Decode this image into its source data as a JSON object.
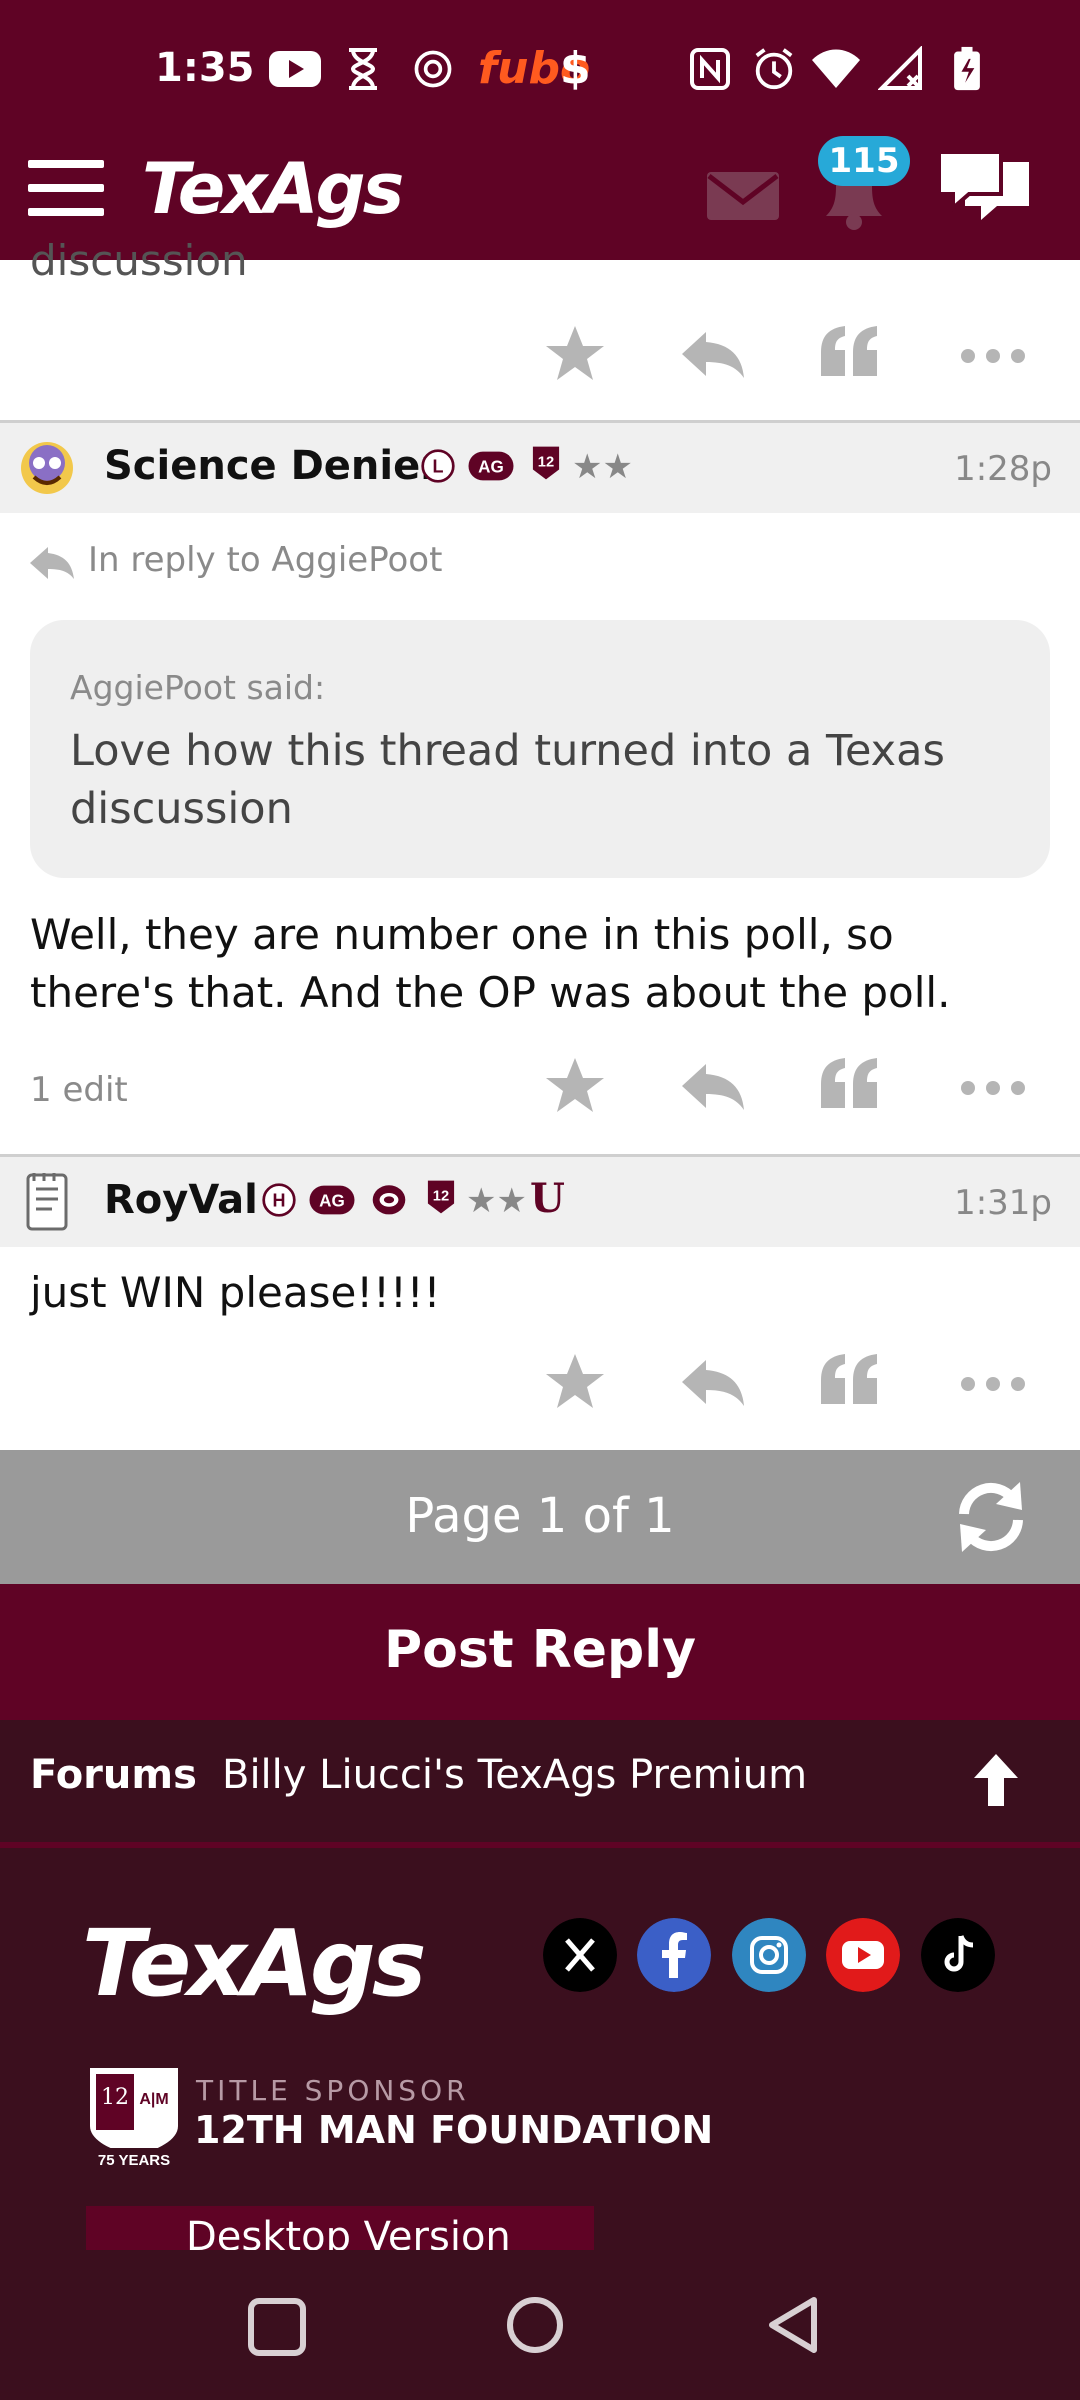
{
  "status_bar": {
    "time": "1:35",
    "icons": [
      "youtube-icon",
      "hourglass-icon",
      "openai-icon",
      "fubo-icon",
      "dollar-icon",
      "nfc-icon",
      "alarm-icon",
      "wifi-icon",
      "signal-icon",
      "battery-icon"
    ],
    "fubo_text": "fubo",
    "dollar_text": "$"
  },
  "header": {
    "logo": "TexAgs",
    "notification_count": "115"
  },
  "posts": [
    {
      "partial_text": "discussion"
    },
    {
      "username": "Science Denier",
      "time": "1:28p",
      "badges": [
        "L",
        "AG",
        "12",
        "★★"
      ],
      "reply_to": "In reply to AggiePoot",
      "quote_author": "AggiePoot said:",
      "quote_text": "Love how this thread turned into a Texas discussion",
      "body": "Well, they are number one in this poll, so there's that. And the OP was about the poll.",
      "edits": "1 edit"
    },
    {
      "username": "RoyVal",
      "time": "1:31p",
      "badges": [
        "H",
        "AG",
        "12",
        "★★",
        "U"
      ],
      "body": "just WIN please!!!!!"
    }
  ],
  "pagination": {
    "label": "Page 1 of 1"
  },
  "post_reply": {
    "label": "Post Reply"
  },
  "breadcrumb": {
    "forums": "Forums",
    "board": "Billy Liucci's TexAgs Premium"
  },
  "footer": {
    "logo": "TexAgs",
    "social": [
      "x-icon",
      "facebook-icon",
      "instagram-icon",
      "youtube-icon",
      "tiktok-icon"
    ],
    "sponsor_label": "TITLE SPONSOR",
    "sponsor_name": "12TH MAN FOUNDATION",
    "sponsor_logo_text": "75 YEARS",
    "desktop_version": "Desktop Version"
  },
  "colors": {
    "brand": "#5f0325",
    "footer": "#3b0f1e",
    "badge_blue": "#27a9d8",
    "pagebar": "#9a9a9a"
  }
}
